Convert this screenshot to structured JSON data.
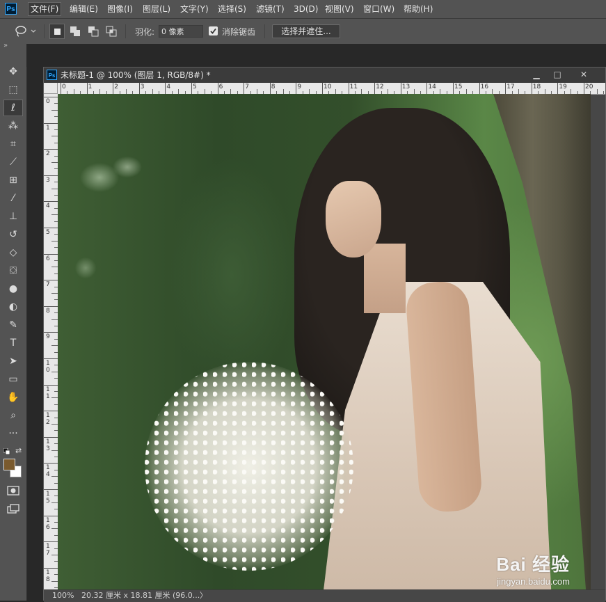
{
  "app": {
    "logo": "Ps"
  },
  "menu": {
    "items": [
      "文件(F)",
      "编辑(E)",
      "图像(I)",
      "图层(L)",
      "文字(Y)",
      "选择(S)",
      "滤镜(T)",
      "3D(D)",
      "视图(V)",
      "窗口(W)",
      "帮助(H)"
    ],
    "active_index": 0
  },
  "options": {
    "feather_label": "羽化:",
    "feather_value": "0 像素",
    "antialias_label": "消除锯齿",
    "antialias_checked": true,
    "select_mask_label": "选择并遮住..."
  },
  "toolbar": {
    "expand_glyph": "»",
    "tools": [
      {
        "name": "move-tool",
        "glyph": "✥"
      },
      {
        "name": "marquee-tool",
        "glyph": "⬚"
      },
      {
        "name": "lasso-tool",
        "glyph": "ℓ",
        "active": true
      },
      {
        "name": "magic-wand-tool",
        "glyph": "⁂"
      },
      {
        "name": "crop-tool",
        "glyph": "⌗"
      },
      {
        "name": "eyedropper-tool",
        "glyph": "⟋"
      },
      {
        "name": "healing-brush-tool",
        "glyph": "⊞"
      },
      {
        "name": "brush-tool",
        "glyph": "⁄"
      },
      {
        "name": "clone-stamp-tool",
        "glyph": "⊥"
      },
      {
        "name": "history-brush-tool",
        "glyph": "↺"
      },
      {
        "name": "eraser-tool",
        "glyph": "◇"
      },
      {
        "name": "paint-bucket-tool",
        "glyph": "⛋"
      },
      {
        "name": "blur-tool",
        "glyph": "●"
      },
      {
        "name": "dodge-tool",
        "glyph": "◐"
      },
      {
        "name": "pen-tool",
        "glyph": "✎"
      },
      {
        "name": "type-tool",
        "glyph": "T"
      },
      {
        "name": "path-selection-tool",
        "glyph": "➤"
      },
      {
        "name": "rectangle-tool",
        "glyph": "▭"
      },
      {
        "name": "hand-tool",
        "glyph": "✋"
      },
      {
        "name": "zoom-tool",
        "glyph": "⌕"
      },
      {
        "name": "edit-toolbar",
        "glyph": "···"
      }
    ],
    "colors": {
      "foreground": "#7a5a2e",
      "background": "#ffffff"
    }
  },
  "document": {
    "title": "未标题-1 @ 100% (图层 1, RGB/8#) *",
    "win_minimize": "▁",
    "win_maximize": "□",
    "win_close": "✕",
    "hruler_labels": [
      "0",
      "1",
      "2",
      "3",
      "4",
      "5",
      "6",
      "7",
      "8",
      "9",
      "10",
      "11",
      "12",
      "13",
      "14",
      "15",
      "16",
      "17",
      "18",
      "19",
      "20"
    ],
    "vruler_labels": [
      "0",
      "1",
      "2",
      "3",
      "4",
      "5",
      "6",
      "7",
      "8",
      "9",
      "10",
      "11",
      "12",
      "13",
      "14",
      "15",
      "16",
      "17",
      "18"
    ]
  },
  "status": {
    "zoom": "100%",
    "doc_size": "20.32 厘米 x 18.81 厘米 (96.0...",
    "arrow": "〉"
  },
  "watermark": {
    "brand": "Bai 经验",
    "url": "jingyan.baidu.com"
  }
}
